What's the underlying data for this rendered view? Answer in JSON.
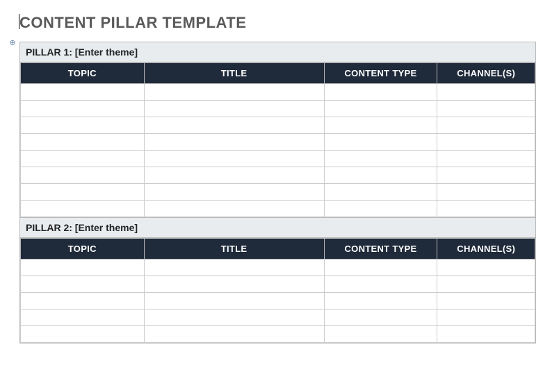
{
  "title": "CONTENT PILLAR TEMPLATE",
  "columns": {
    "topic": "TOPIC",
    "title": "TITLE",
    "content_type": "CONTENT TYPE",
    "channels": "CHANNEL(S)"
  },
  "pillars": [
    {
      "label": "PILLAR 1: [Enter theme]",
      "row_count": 8
    },
    {
      "label": "PILLAR 2: [Enter theme]",
      "row_count": 5
    }
  ]
}
